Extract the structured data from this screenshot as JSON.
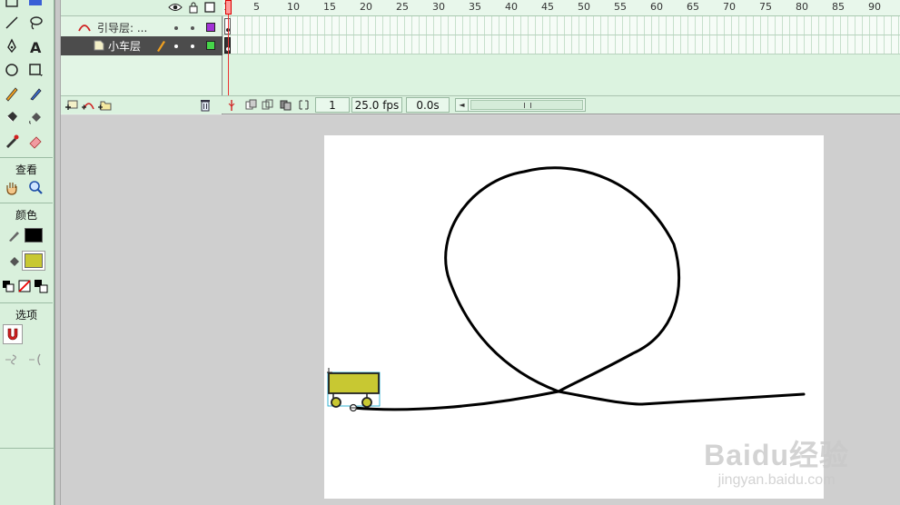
{
  "tools": {
    "view_label": "查看",
    "color_label": "颜色",
    "options_label": "选项",
    "stroke_color": "#000000",
    "fill_color": "#c8c832"
  },
  "timeline": {
    "layers": [
      {
        "name": "引导层: ...",
        "color": "#a233d6",
        "type": "guide"
      },
      {
        "name": "小车层",
        "color": "#46d64a",
        "type": "normal",
        "selected": true
      }
    ],
    "ruler_ticks": [
      "1",
      "5",
      "10",
      "15",
      "20",
      "25",
      "30",
      "35",
      "40",
      "45",
      "50",
      "55",
      "60",
      "65",
      "70",
      "75",
      "80",
      "85",
      "90"
    ],
    "current_frame": "1",
    "fps": "25.0 fps",
    "elapsed": "0.0s"
  },
  "stage": {
    "background": "#ffffff",
    "cart_color": "#c8c832"
  },
  "watermark": {
    "brand": "Baidu经验",
    "url": "jingyan.baidu.com"
  }
}
